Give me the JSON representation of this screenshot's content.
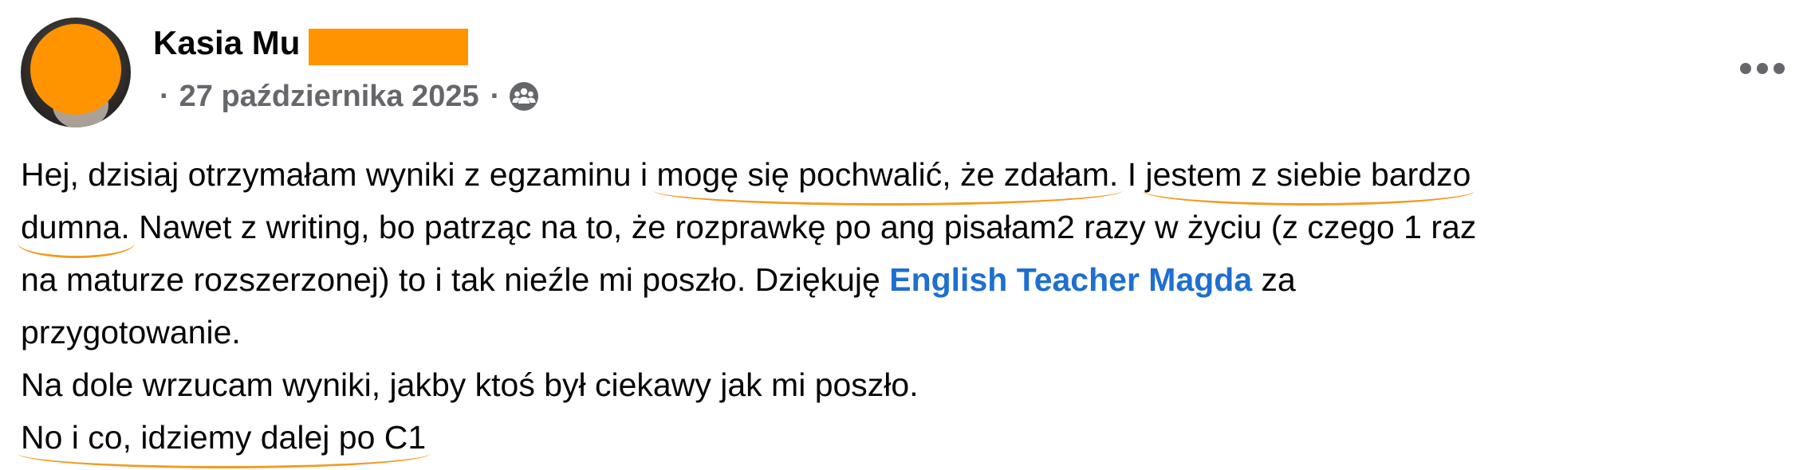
{
  "author": {
    "name": "Kasia Mu"
  },
  "meta": {
    "dot_before": "·",
    "date": "27 października 2025",
    "dot_after": "·",
    "audience_icon": "friends-icon"
  },
  "more_icon": "more-horizontal-icon",
  "post": {
    "line1": {
      "a": "Hej, dzisiaj otrzymałam wyniki z egzaminu i ",
      "b": "mogę się pochwalić, że zdałam.",
      "c": " I ",
      "d": "jestem z siebie bardzo"
    },
    "line2": {
      "a": "dumna.",
      "b": " Nawet z writing, bo patrząc na to, że rozprawkę po ang pisałam2 razy w życiu (z czego 1 raz"
    },
    "line3": {
      "a": "na maturze rozszerzonej) to i tak nieźle mi poszło. Dziękuję ",
      "mention": "English Teacher Magda",
      "b": " za"
    },
    "line4": "przygotowanie.",
    "line5": "Na dole wrzucam wyniki, jakby ktoś był ciekawy jak mi poszło.",
    "line6": "No i co, idziemy dalej po C1"
  },
  "colors": {
    "redaction": "#ff9400",
    "underline": "#f29a1e",
    "mention": "#1e6fd0",
    "meta": "#65676b"
  }
}
